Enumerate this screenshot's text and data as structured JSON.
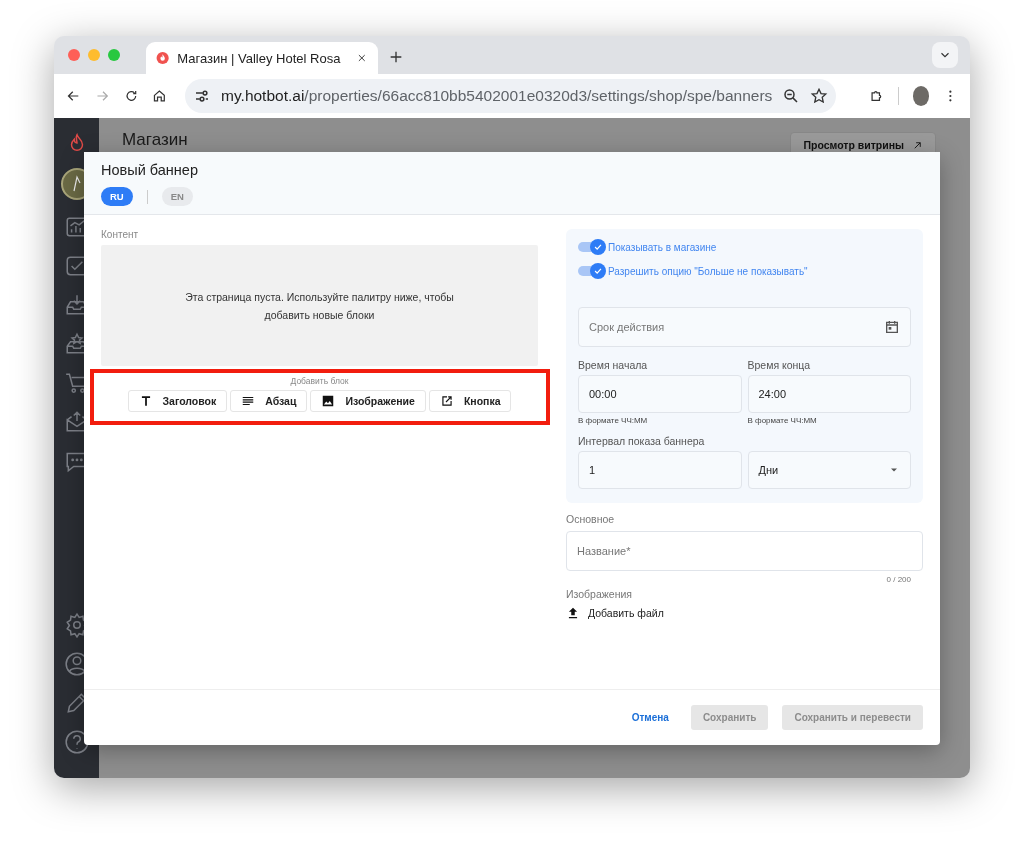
{
  "browser": {
    "tab_title": "Магазин | Valley Hotel Rosa",
    "url_domain": "my.hotbot.ai",
    "url_path": "/properties/66acc810bb5402001e0320d3/settings/shop/spe/banners"
  },
  "page": {
    "title": "Магазин",
    "preview_button": "Просмотр витрины"
  },
  "modal": {
    "title": "Новый баннер",
    "languages": [
      {
        "label": "RU",
        "selected": true
      },
      {
        "label": "EN",
        "selected": false
      }
    ],
    "content_label": "Контент",
    "empty_text": "Эта страница пуста. Используйте палитру ниже, чтобы добавить новые блоки",
    "add_block_label": "Добавить блок",
    "blocks": [
      {
        "kind": "heading",
        "label": "Заголовок"
      },
      {
        "kind": "paragraph",
        "label": "Абзац"
      },
      {
        "kind": "image",
        "label": "Изображение"
      },
      {
        "kind": "button",
        "label": "Кнопка"
      }
    ],
    "toggles": [
      {
        "label": "Показывать в магазине",
        "on": true
      },
      {
        "label": "Разрешить опцию \"Больше не показывать\"",
        "on": true
      }
    ],
    "expiry": {
      "placeholder": "Срок действия"
    },
    "times": [
      {
        "label": "Время начала",
        "value": "00:00",
        "hint": "В формате ЧЧ:ММ"
      },
      {
        "label": "Время конца",
        "value": "24:00",
        "hint": "В формате ЧЧ:ММ"
      }
    ],
    "interval": {
      "label": "Интервал показа баннера",
      "value": "1",
      "unit": "Дни"
    },
    "main_label": "Основное",
    "name_field": {
      "placeholder": "Название*",
      "counter": "0 / 200"
    },
    "images_label": "Изображения",
    "add_file": "Добавить файл",
    "footer": {
      "cancel": "Отмена",
      "buttons": [
        {
          "label": "Сохранить",
          "disabled": true
        },
        {
          "label": "Сохранить и перевести",
          "disabled": true
        }
      ]
    }
  }
}
